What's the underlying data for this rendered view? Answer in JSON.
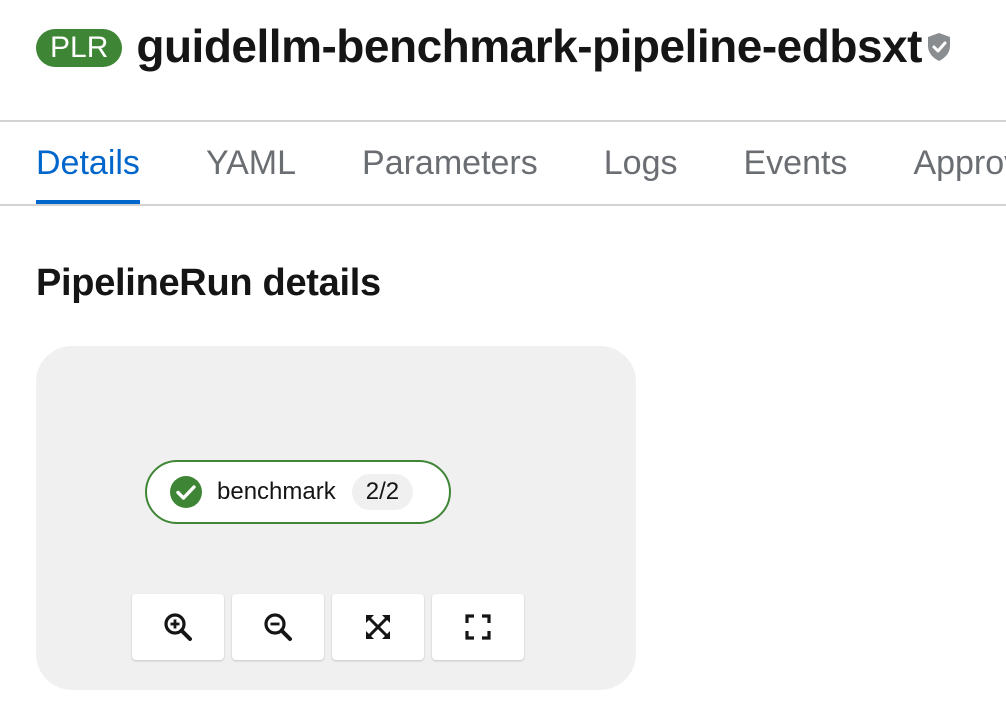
{
  "header": {
    "badge": "PLR",
    "title": "guidellm-benchmark-pipeline-edbsxt",
    "shield_icon": "shield-icon"
  },
  "tabs": [
    {
      "label": "Details",
      "active": true
    },
    {
      "label": "YAML",
      "active": false
    },
    {
      "label": "Parameters",
      "active": false
    },
    {
      "label": "Logs",
      "active": false
    },
    {
      "label": "Events",
      "active": false
    },
    {
      "label": "Approvals",
      "active": false
    }
  ],
  "section": {
    "title": "PipelineRun details"
  },
  "topology": {
    "node": {
      "label": "benchmark",
      "count": "2/2",
      "status": "succeeded",
      "status_icon": "check-circle-icon",
      "status_color": "#3e8635"
    },
    "controls": [
      {
        "name": "zoom-in-button",
        "icon": "zoom-in-icon"
      },
      {
        "name": "zoom-out-button",
        "icon": "zoom-out-icon"
      },
      {
        "name": "fit-to-screen-button",
        "icon": "expand-arrows-icon"
      },
      {
        "name": "reset-view-button",
        "icon": "fullscreen-icon"
      }
    ]
  },
  "colors": {
    "accent": "#0066cc",
    "success": "#3e8635",
    "panel_bg": "#f0f0f0"
  }
}
